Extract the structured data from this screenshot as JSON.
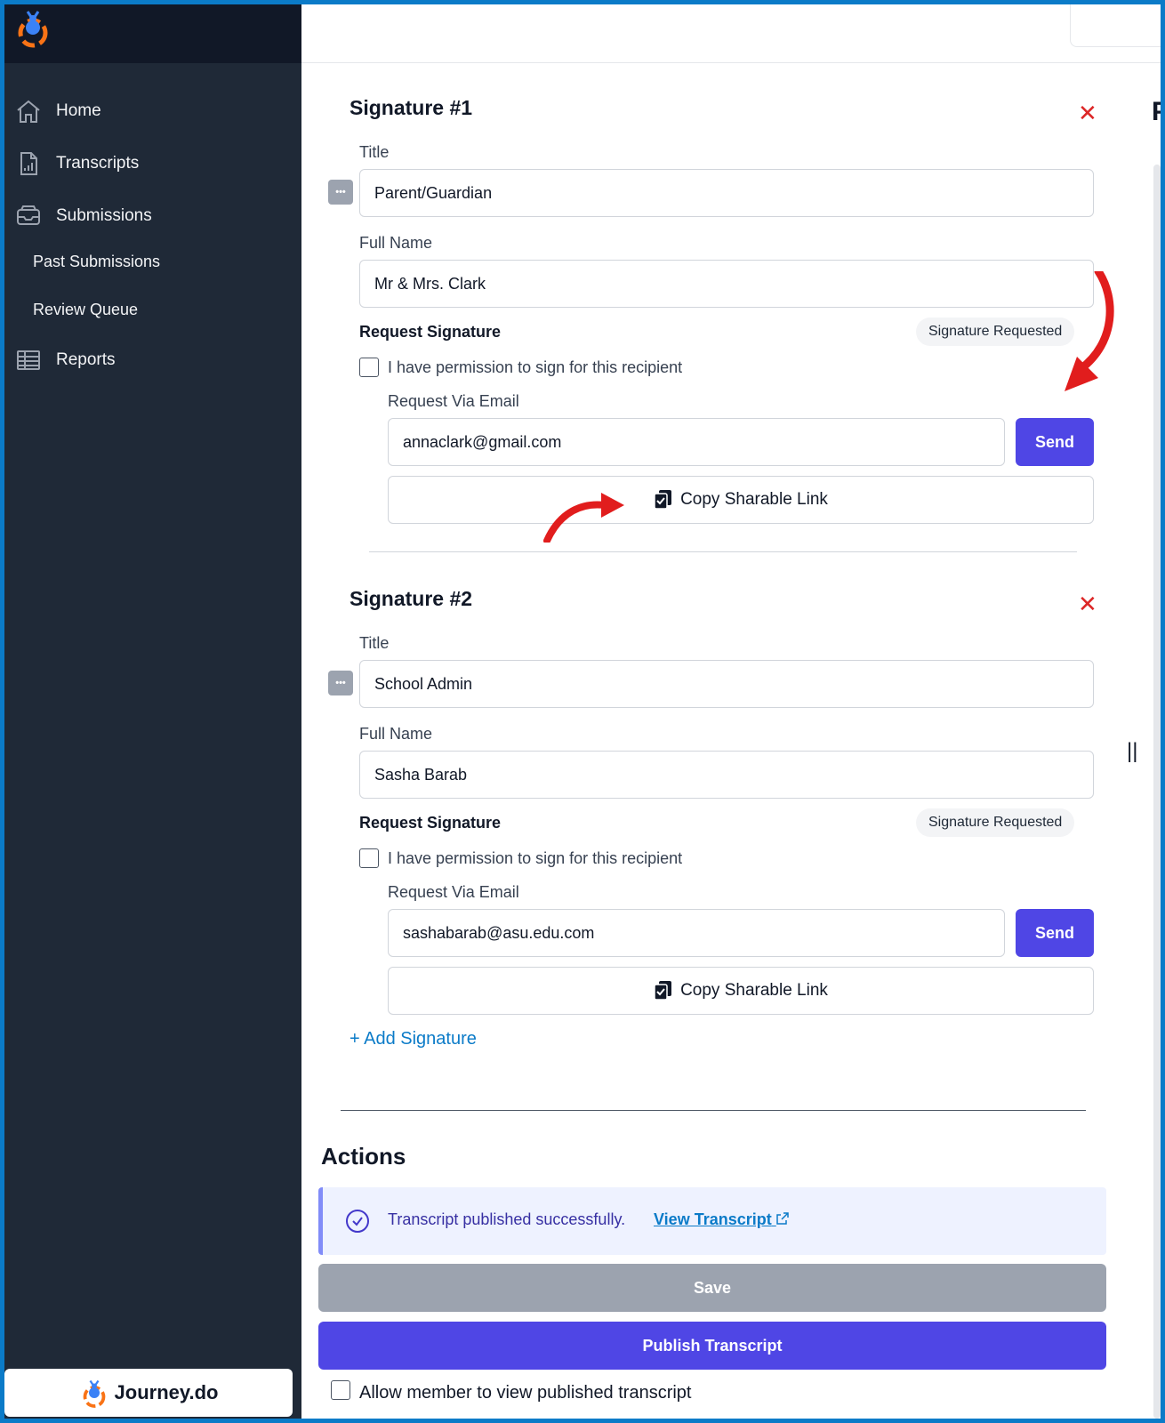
{
  "sidebar": {
    "nav": [
      {
        "label": "Home",
        "icon": "home-icon"
      },
      {
        "label": "Transcripts",
        "icon": "document-chart-icon"
      },
      {
        "label": "Submissions",
        "icon": "inbox-icon"
      }
    ],
    "sub_items": [
      "Past Submissions",
      "Review Queue"
    ],
    "reports": {
      "label": "Reports",
      "icon": "table-icon"
    },
    "brand": "Journey.do"
  },
  "right_edge_text": "P",
  "signatures": [
    {
      "heading": "Signature #1",
      "title_label": "Title",
      "title_value": "Parent/Guardian",
      "name_label": "Full Name",
      "name_value": "Mr & Mrs. Clark",
      "request_label": "Request Signature",
      "badge": "Signature Requested",
      "permission_label": "I have permission to sign for this recipient",
      "email_label": "Request Via Email",
      "email_value": "annaclark@gmail.com",
      "send_label": "Send",
      "copy_label": "Copy Sharable Link"
    },
    {
      "heading": "Signature #2",
      "title_label": "Title",
      "title_value": "School Admin",
      "name_label": "Full Name",
      "name_value": "Sasha Barab",
      "request_label": "Request Signature",
      "badge": "Signature Requested",
      "permission_label": "I have permission to sign for this recipient",
      "email_label": "Request Via Email",
      "email_value": "sashabarab@asu.edu.com",
      "send_label": "Send",
      "copy_label": "Copy Sharable Link"
    }
  ],
  "add_signature_label": "+ Add Signature",
  "actions": {
    "title": "Actions",
    "alert_text": "Transcript published successfully.",
    "alert_link": "View Transcript",
    "save_label": "Save",
    "publish_label": "Publish Transcript",
    "allow_label": "Allow member to view published transcript"
  },
  "colors": {
    "primary": "#4f46e5",
    "sidebar": "#1f2937",
    "link": "#0b7bc8",
    "danger": "#dc2626",
    "annotation": "#e11d1d"
  }
}
